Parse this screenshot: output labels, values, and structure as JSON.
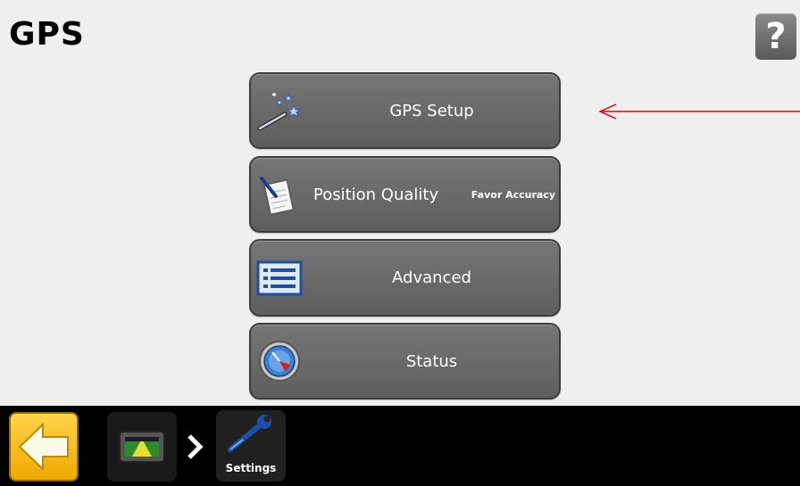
{
  "header": {
    "title": "GPS",
    "help_label": "?"
  },
  "menu": {
    "gps_setup": "GPS Setup",
    "position_quality": "Position Quality",
    "position_quality_value": "Favor Accuracy",
    "advanced": "Advanced",
    "status": "Status"
  },
  "breadcrumb": {
    "settings_label": "Settings"
  },
  "colors": {
    "annotation_arrow": "#e00000",
    "button_bg": "#6a6a6a",
    "back_button": "#f7b500"
  },
  "icons": {
    "gps_setup": "magic-wand-icon",
    "position_quality": "notepad-pen-icon",
    "advanced": "list-icon",
    "status": "gauge-icon",
    "back": "back-arrow-icon",
    "display": "display-icon",
    "settings": "wrench-icon"
  }
}
